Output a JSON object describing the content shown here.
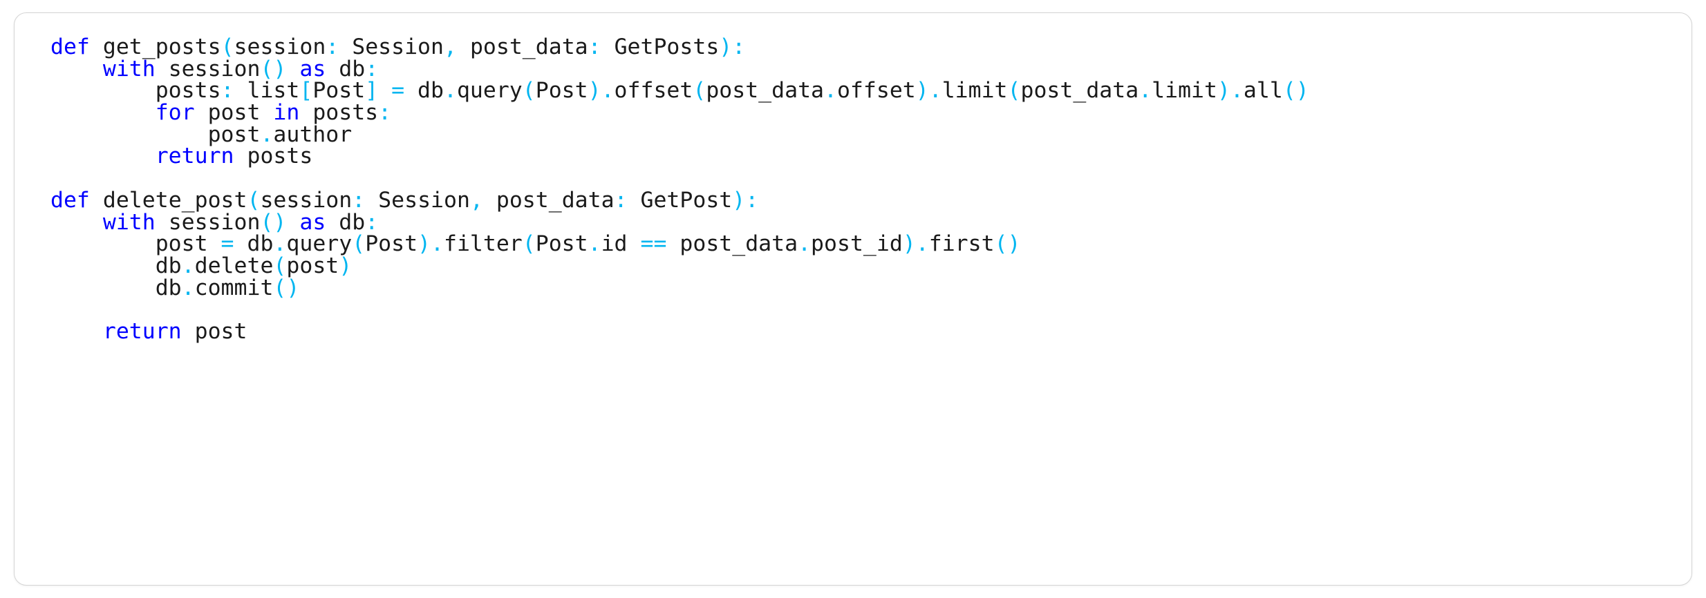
{
  "card": {
    "background": "#ffffff",
    "border_color": "#d4d4d4",
    "corner_radius_px": 18
  },
  "theme": {
    "keyword_color": "#0000ff",
    "punctuation_color": "#00b5f0",
    "operator_color": "#00b5f0",
    "identifier_color": "#1a1a1a",
    "background_color": "#ffffff",
    "font_size_px": 31.5
  },
  "code": {
    "language": "python",
    "indent_size": 4,
    "line_count": 15,
    "text": "def get_posts(session: Session, post_data: GetPosts):\n    with session() as db:\n        posts: list[Post] = db.query(Post).offset(post_data.offset).limit(post_data.limit).all()\n        for post in posts:\n            post.author\n        return posts\n\ndef delete_post(session: Session, post_data: GetPost):\n    with session() as db:\n        post = db.query(Post).filter(Post.id == post_data.post_id).first()\n        db.delete(post)\n        db.commit()\n\n    return post",
    "lines": [
      {
        "number": 1,
        "indent": 0,
        "tokens": [
          {
            "t": "def",
            "c": "kw"
          },
          {
            "t": " ",
            "c": "id"
          },
          {
            "t": "get_posts",
            "c": "id"
          },
          {
            "t": "(",
            "c": "pn"
          },
          {
            "t": "session",
            "c": "id"
          },
          {
            "t": ":",
            "c": "pn"
          },
          {
            "t": " ",
            "c": "id"
          },
          {
            "t": "Session",
            "c": "id"
          },
          {
            "t": ",",
            "c": "pn"
          },
          {
            "t": " ",
            "c": "id"
          },
          {
            "t": "post_data",
            "c": "id"
          },
          {
            "t": ":",
            "c": "pn"
          },
          {
            "t": " ",
            "c": "id"
          },
          {
            "t": "GetPosts",
            "c": "id"
          },
          {
            "t": ")",
            "c": "pn"
          },
          {
            "t": ":",
            "c": "pn"
          }
        ]
      },
      {
        "number": 2,
        "indent": 4,
        "tokens": [
          {
            "t": "    ",
            "c": "id"
          },
          {
            "t": "with",
            "c": "kw"
          },
          {
            "t": " ",
            "c": "id"
          },
          {
            "t": "session",
            "c": "id"
          },
          {
            "t": "(",
            "c": "pn"
          },
          {
            "t": ")",
            "c": "pn"
          },
          {
            "t": " ",
            "c": "id"
          },
          {
            "t": "as",
            "c": "kw"
          },
          {
            "t": " ",
            "c": "id"
          },
          {
            "t": "db",
            "c": "id"
          },
          {
            "t": ":",
            "c": "pn"
          }
        ]
      },
      {
        "number": 3,
        "indent": 8,
        "tokens": [
          {
            "t": "        ",
            "c": "id"
          },
          {
            "t": "posts",
            "c": "id"
          },
          {
            "t": ":",
            "c": "pn"
          },
          {
            "t": " ",
            "c": "id"
          },
          {
            "t": "list",
            "c": "id"
          },
          {
            "t": "[",
            "c": "pn"
          },
          {
            "t": "Post",
            "c": "id"
          },
          {
            "t": "]",
            "c": "pn"
          },
          {
            "t": " ",
            "c": "id"
          },
          {
            "t": "=",
            "c": "op"
          },
          {
            "t": " ",
            "c": "id"
          },
          {
            "t": "db",
            "c": "id"
          },
          {
            "t": ".",
            "c": "pn"
          },
          {
            "t": "query",
            "c": "id"
          },
          {
            "t": "(",
            "c": "pn"
          },
          {
            "t": "Post",
            "c": "id"
          },
          {
            "t": ")",
            "c": "pn"
          },
          {
            "t": ".",
            "c": "pn"
          },
          {
            "t": "offset",
            "c": "id"
          },
          {
            "t": "(",
            "c": "pn"
          },
          {
            "t": "post_data",
            "c": "id"
          },
          {
            "t": ".",
            "c": "pn"
          },
          {
            "t": "offset",
            "c": "id"
          },
          {
            "t": ")",
            "c": "pn"
          },
          {
            "t": ".",
            "c": "pn"
          },
          {
            "t": "limit",
            "c": "id"
          },
          {
            "t": "(",
            "c": "pn"
          },
          {
            "t": "post_data",
            "c": "id"
          },
          {
            "t": ".",
            "c": "pn"
          },
          {
            "t": "limit",
            "c": "id"
          },
          {
            "t": ")",
            "c": "pn"
          },
          {
            "t": ".",
            "c": "pn"
          },
          {
            "t": "all",
            "c": "id"
          },
          {
            "t": "(",
            "c": "pn"
          },
          {
            "t": ")",
            "c": "pn"
          }
        ]
      },
      {
        "number": 4,
        "indent": 8,
        "tokens": [
          {
            "t": "        ",
            "c": "id"
          },
          {
            "t": "for",
            "c": "kw"
          },
          {
            "t": " ",
            "c": "id"
          },
          {
            "t": "post",
            "c": "id"
          },
          {
            "t": " ",
            "c": "id"
          },
          {
            "t": "in",
            "c": "kw"
          },
          {
            "t": " ",
            "c": "id"
          },
          {
            "t": "posts",
            "c": "id"
          },
          {
            "t": ":",
            "c": "pn"
          }
        ]
      },
      {
        "number": 5,
        "indent": 12,
        "tokens": [
          {
            "t": "            ",
            "c": "id"
          },
          {
            "t": "post",
            "c": "id"
          },
          {
            "t": ".",
            "c": "pn"
          },
          {
            "t": "author",
            "c": "id"
          }
        ]
      },
      {
        "number": 6,
        "indent": 8,
        "tokens": [
          {
            "t": "        ",
            "c": "id"
          },
          {
            "t": "return",
            "c": "kw"
          },
          {
            "t": " ",
            "c": "id"
          },
          {
            "t": "posts",
            "c": "id"
          }
        ]
      },
      {
        "number": 7,
        "indent": 0,
        "tokens": []
      },
      {
        "number": 8,
        "indent": 0,
        "tokens": [
          {
            "t": "def",
            "c": "kw"
          },
          {
            "t": " ",
            "c": "id"
          },
          {
            "t": "delete_post",
            "c": "id"
          },
          {
            "t": "(",
            "c": "pn"
          },
          {
            "t": "session",
            "c": "id"
          },
          {
            "t": ":",
            "c": "pn"
          },
          {
            "t": " ",
            "c": "id"
          },
          {
            "t": "Session",
            "c": "id"
          },
          {
            "t": ",",
            "c": "pn"
          },
          {
            "t": " ",
            "c": "id"
          },
          {
            "t": "post_data",
            "c": "id"
          },
          {
            "t": ":",
            "c": "pn"
          },
          {
            "t": " ",
            "c": "id"
          },
          {
            "t": "GetPost",
            "c": "id"
          },
          {
            "t": ")",
            "c": "pn"
          },
          {
            "t": ":",
            "c": "pn"
          }
        ]
      },
      {
        "number": 9,
        "indent": 4,
        "tokens": [
          {
            "t": "    ",
            "c": "id"
          },
          {
            "t": "with",
            "c": "kw"
          },
          {
            "t": " ",
            "c": "id"
          },
          {
            "t": "session",
            "c": "id"
          },
          {
            "t": "(",
            "c": "pn"
          },
          {
            "t": ")",
            "c": "pn"
          },
          {
            "t": " ",
            "c": "id"
          },
          {
            "t": "as",
            "c": "kw"
          },
          {
            "t": " ",
            "c": "id"
          },
          {
            "t": "db",
            "c": "id"
          },
          {
            "t": ":",
            "c": "pn"
          }
        ]
      },
      {
        "number": 10,
        "indent": 8,
        "tokens": [
          {
            "t": "        ",
            "c": "id"
          },
          {
            "t": "post",
            "c": "id"
          },
          {
            "t": " ",
            "c": "id"
          },
          {
            "t": "=",
            "c": "op"
          },
          {
            "t": " ",
            "c": "id"
          },
          {
            "t": "db",
            "c": "id"
          },
          {
            "t": ".",
            "c": "pn"
          },
          {
            "t": "query",
            "c": "id"
          },
          {
            "t": "(",
            "c": "pn"
          },
          {
            "t": "Post",
            "c": "id"
          },
          {
            "t": ")",
            "c": "pn"
          },
          {
            "t": ".",
            "c": "pn"
          },
          {
            "t": "filter",
            "c": "id"
          },
          {
            "t": "(",
            "c": "pn"
          },
          {
            "t": "Post",
            "c": "id"
          },
          {
            "t": ".",
            "c": "pn"
          },
          {
            "t": "id",
            "c": "id"
          },
          {
            "t": " ",
            "c": "id"
          },
          {
            "t": "==",
            "c": "op"
          },
          {
            "t": " ",
            "c": "id"
          },
          {
            "t": "post_data",
            "c": "id"
          },
          {
            "t": ".",
            "c": "pn"
          },
          {
            "t": "post_id",
            "c": "id"
          },
          {
            "t": ")",
            "c": "pn"
          },
          {
            "t": ".",
            "c": "pn"
          },
          {
            "t": "first",
            "c": "id"
          },
          {
            "t": "(",
            "c": "pn"
          },
          {
            "t": ")",
            "c": "pn"
          }
        ]
      },
      {
        "number": 11,
        "indent": 8,
        "tokens": [
          {
            "t": "        ",
            "c": "id"
          },
          {
            "t": "db",
            "c": "id"
          },
          {
            "t": ".",
            "c": "pn"
          },
          {
            "t": "delete",
            "c": "id"
          },
          {
            "t": "(",
            "c": "pn"
          },
          {
            "t": "post",
            "c": "id"
          },
          {
            "t": ")",
            "c": "pn"
          }
        ]
      },
      {
        "number": 12,
        "indent": 8,
        "tokens": [
          {
            "t": "        ",
            "c": "id"
          },
          {
            "t": "db",
            "c": "id"
          },
          {
            "t": ".",
            "c": "pn"
          },
          {
            "t": "commit",
            "c": "id"
          },
          {
            "t": "(",
            "c": "pn"
          },
          {
            "t": ")",
            "c": "pn"
          }
        ]
      },
      {
        "number": 13,
        "indent": 0,
        "tokens": []
      },
      {
        "number": 14,
        "indent": 4,
        "tokens": [
          {
            "t": "    ",
            "c": "id"
          },
          {
            "t": "return",
            "c": "kw"
          },
          {
            "t": " ",
            "c": "id"
          },
          {
            "t": "post",
            "c": "id"
          }
        ]
      },
      {
        "number": 15,
        "indent": 0,
        "tokens": []
      }
    ]
  }
}
